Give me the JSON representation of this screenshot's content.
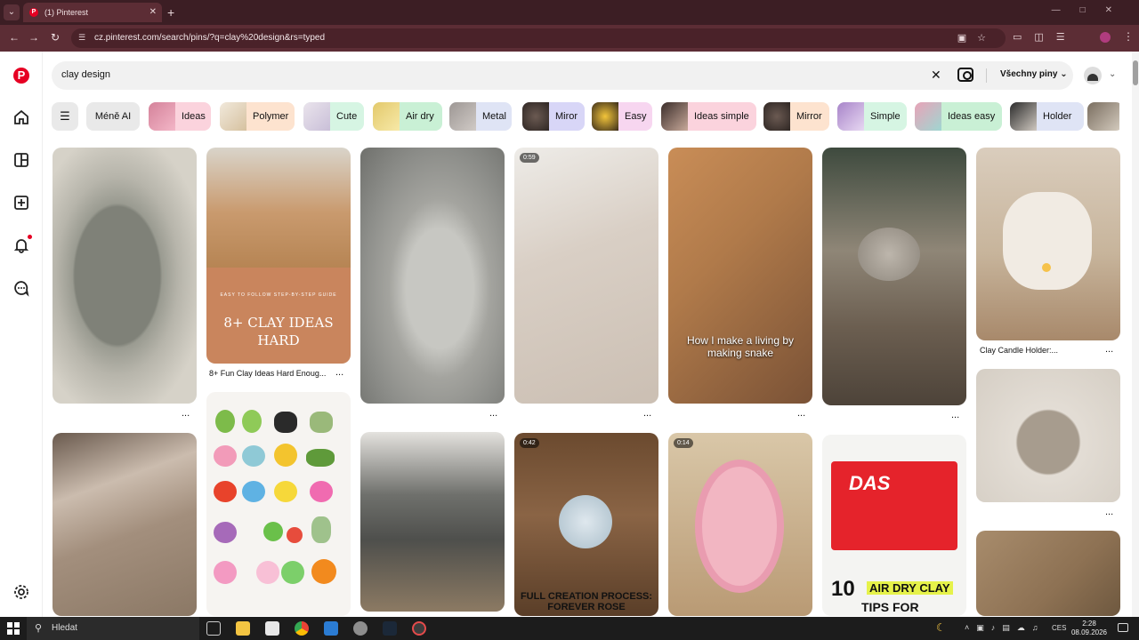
{
  "browser": {
    "tab_title": "(1) Pinterest",
    "url": "cz.pinterest.com/search/pins/?q=clay%20design&rs=typed"
  },
  "search": {
    "query": "clay design",
    "filter_label": "Všechny piny"
  },
  "chips": [
    {
      "label": "Méně AI",
      "bg": "#e9e9e9"
    },
    {
      "label": "Ideas",
      "bg": "#fbd3dd"
    },
    {
      "label": "Polymer",
      "bg": "#fde3cf"
    },
    {
      "label": "Cute",
      "bg": "#d6f5e3"
    },
    {
      "label": "Air dry",
      "bg": "#c9f0d5"
    },
    {
      "label": "Metal",
      "bg": "#dfe4f5"
    },
    {
      "label": "Miror",
      "bg": "#d8d6f7"
    },
    {
      "label": "Easy",
      "bg": "#f7d6f0"
    },
    {
      "label": "Ideas simple",
      "bg": "#fbd3dd"
    },
    {
      "label": "Mirror",
      "bg": "#fde3cf"
    },
    {
      "label": "Simple",
      "bg": "#d6f5e3"
    },
    {
      "label": "Ideas easy",
      "bg": "#c9f0d5"
    },
    {
      "label": "Holder",
      "bg": "#dfe4f5"
    }
  ],
  "pins": {
    "p2_banner_sub": "EASY TO FOLLOW STEP-BY-STEP GUIDE",
    "p2_banner": "8+ CLAY IDEAS HARD",
    "p2_caption": "8+ Fun Clay Ideas Hard Enoug...",
    "p4_duration": "0:59",
    "p5_overlay": "How I make a living by making snake",
    "p7_caption": "Clay Candle Holder:...",
    "p10_duration": "0:42",
    "p10_overlay": "FULL CREATION PROCESS: FOREVER ROSE",
    "p11_duration": "0:14",
    "p12_brand": "DAS",
    "p12_title_num": "10",
    "p12_title_a": "AIR DRY CLAY",
    "p12_title_b": "TIPS FOR",
    "more": "..."
  },
  "taskbar": {
    "search_placeholder": "Hledat",
    "lang": "CES",
    "time": "2:28",
    "date": "08.09.2026"
  }
}
